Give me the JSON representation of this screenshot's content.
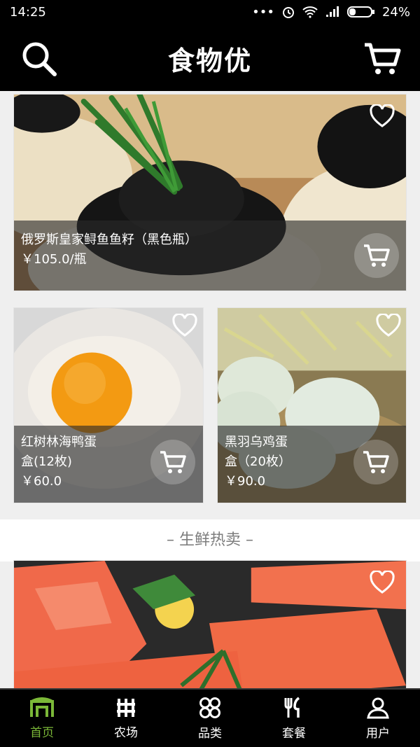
{
  "status_bar": {
    "time": "14:25",
    "battery": "24%"
  },
  "header": {
    "title": "食物优"
  },
  "products": [
    {
      "name": "俄罗斯皇家鲟鱼鱼籽（黑色瓶）",
      "price": "￥105.0/瓶",
      "image": "caviar"
    },
    {
      "name_line1": "红树林海鸭蛋",
      "name_line2": "盒(12枚)",
      "price": "￥60.0",
      "image": "duck-egg"
    },
    {
      "name_line1": "黑羽乌鸡蛋",
      "name_line2": "盒（20枚）",
      "price": "￥90.0",
      "image": "black-chicken-eggs"
    },
    {
      "image": "salmon"
    }
  ],
  "section": {
    "title": "– 生鲜热卖 –"
  },
  "nav": {
    "items": [
      {
        "label": "首页",
        "icon": "home-icon",
        "active": true
      },
      {
        "label": "农场",
        "icon": "farm-icon"
      },
      {
        "label": "品类",
        "icon": "category-icon"
      },
      {
        "label": "套餐",
        "icon": "meal-icon"
      },
      {
        "label": "用户",
        "icon": "user-icon"
      }
    ]
  },
  "colors": {
    "active": "#7bb838",
    "bar": "#000000"
  }
}
